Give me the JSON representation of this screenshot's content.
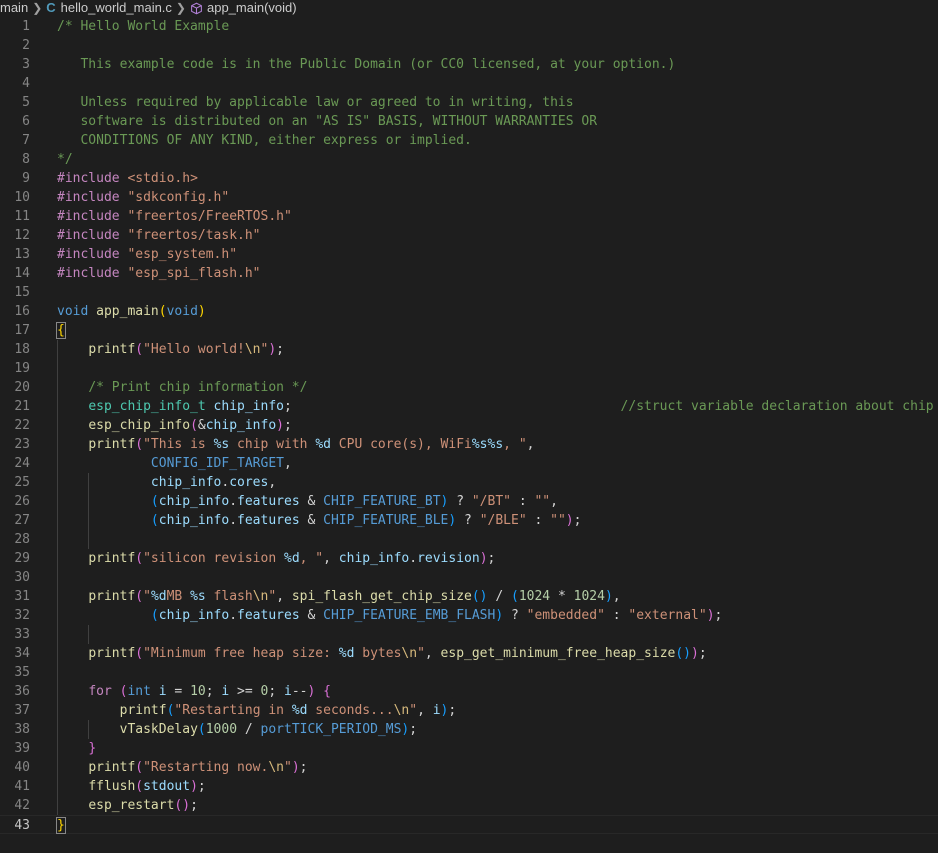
{
  "breadcrumb": {
    "folder": "main",
    "file": "hello_world_main.c",
    "file_icon": "C",
    "symbol": "app_main(void)"
  },
  "editor": {
    "current_line": 43,
    "lines": [
      {
        "n": "1",
        "t": [
          [
            "cm",
            "/* Hello World Example"
          ]
        ]
      },
      {
        "n": "2",
        "t": []
      },
      {
        "n": "3",
        "t": [
          [
            "cm",
            "   This example code is in the Public Domain (or CC0 licensed, at your option.)"
          ]
        ]
      },
      {
        "n": "4",
        "t": []
      },
      {
        "n": "5",
        "t": [
          [
            "cm",
            "   Unless required by applicable law or agreed to in writing, this"
          ]
        ]
      },
      {
        "n": "6",
        "t": [
          [
            "cm",
            "   software is distributed on an \"AS IS\" BASIS, WITHOUT WARRANTIES OR"
          ]
        ]
      },
      {
        "n": "7",
        "t": [
          [
            "cm",
            "   CONDITIONS OF ANY KIND, either express or implied."
          ]
        ]
      },
      {
        "n": "8",
        "t": [
          [
            "cm",
            "*/"
          ]
        ]
      },
      {
        "n": "9",
        "t": [
          [
            "pp",
            "#include "
          ],
          [
            "str",
            "<stdio.h>"
          ]
        ]
      },
      {
        "n": "10",
        "t": [
          [
            "pp",
            "#include "
          ],
          [
            "str",
            "\"sdkconfig.h\""
          ]
        ]
      },
      {
        "n": "11",
        "t": [
          [
            "pp",
            "#include "
          ],
          [
            "str",
            "\"freertos/FreeRTOS.h\""
          ]
        ]
      },
      {
        "n": "12",
        "t": [
          [
            "pp",
            "#include "
          ],
          [
            "str",
            "\"freertos/task.h\""
          ]
        ]
      },
      {
        "n": "13",
        "t": [
          [
            "pp",
            "#include "
          ],
          [
            "str",
            "\"esp_system.h\""
          ]
        ]
      },
      {
        "n": "14",
        "t": [
          [
            "pp",
            "#include "
          ],
          [
            "str",
            "\"esp_spi_flash.h\""
          ]
        ]
      },
      {
        "n": "15",
        "t": []
      },
      {
        "n": "16",
        "t": [
          [
            "kw",
            "void "
          ],
          [
            "fn",
            "app_main"
          ],
          [
            "br1",
            "("
          ],
          [
            "kw",
            "void"
          ],
          [
            "br1",
            ")"
          ]
        ]
      },
      {
        "n": "17",
        "t": [
          [
            "br1 brace-match",
            "{"
          ]
        ]
      },
      {
        "n": "18",
        "t": [
          [
            "pl",
            "    "
          ],
          [
            "fn",
            "printf"
          ],
          [
            "br2",
            "("
          ],
          [
            "str",
            "\"Hello world!"
          ],
          [
            "esc",
            "\\n"
          ],
          [
            "str",
            "\""
          ],
          [
            "br2",
            ")"
          ],
          [
            "pl",
            ";"
          ]
        ]
      },
      {
        "n": "19",
        "t": []
      },
      {
        "n": "20",
        "t": [
          [
            "pl",
            "    "
          ],
          [
            "cm",
            "/* Print chip information */"
          ]
        ]
      },
      {
        "n": "21",
        "t": [
          [
            "pl",
            "    "
          ],
          [
            "ty",
            "esp_chip_info_t "
          ],
          [
            "var",
            "chip_info"
          ],
          [
            "pl",
            ";                                          "
          ],
          [
            "cm",
            "//struct variable declaration about chip info"
          ]
        ]
      },
      {
        "n": "22",
        "t": [
          [
            "pl",
            "    "
          ],
          [
            "fn",
            "esp_chip_info"
          ],
          [
            "br2",
            "("
          ],
          [
            "pl",
            "&"
          ],
          [
            "var",
            "chip_info"
          ],
          [
            "br2",
            ")"
          ],
          [
            "pl",
            ";"
          ]
        ]
      },
      {
        "n": "23",
        "t": [
          [
            "pl",
            "    "
          ],
          [
            "fn",
            "printf"
          ],
          [
            "br2",
            "("
          ],
          [
            "str",
            "\"This is "
          ],
          [
            "fmt",
            "%s"
          ],
          [
            "str",
            " chip with "
          ],
          [
            "fmt",
            "%d"
          ],
          [
            "str",
            " CPU core(s), WiFi"
          ],
          [
            "fmt",
            "%s%s"
          ],
          [
            "str",
            ", \""
          ],
          [
            "pl",
            ","
          ]
        ]
      },
      {
        "n": "24",
        "t": [
          [
            "pl",
            "            "
          ],
          [
            "mac",
            "CONFIG_IDF_TARGET"
          ],
          [
            "pl",
            ","
          ]
        ]
      },
      {
        "n": "25",
        "t": [
          [
            "pl",
            "            "
          ],
          [
            "var",
            "chip_info"
          ],
          [
            "pl",
            "."
          ],
          [
            "var",
            "cores"
          ],
          [
            "pl",
            ","
          ]
        ]
      },
      {
        "n": "26",
        "t": [
          [
            "pl",
            "            "
          ],
          [
            "br3",
            "("
          ],
          [
            "var",
            "chip_info"
          ],
          [
            "pl",
            "."
          ],
          [
            "var",
            "features"
          ],
          [
            "pl",
            " & "
          ],
          [
            "mac",
            "CHIP_FEATURE_BT"
          ],
          [
            "br3",
            ")"
          ],
          [
            "pl",
            " ? "
          ],
          [
            "str",
            "\"/BT\""
          ],
          [
            "pl",
            " : "
          ],
          [
            "str",
            "\"\""
          ],
          [
            "pl",
            ","
          ]
        ]
      },
      {
        "n": "27",
        "t": [
          [
            "pl",
            "            "
          ],
          [
            "br3",
            "("
          ],
          [
            "var",
            "chip_info"
          ],
          [
            "pl",
            "."
          ],
          [
            "var",
            "features"
          ],
          [
            "pl",
            " & "
          ],
          [
            "mac",
            "CHIP_FEATURE_BLE"
          ],
          [
            "br3",
            ")"
          ],
          [
            "pl",
            " ? "
          ],
          [
            "str",
            "\"/BLE\""
          ],
          [
            "pl",
            " : "
          ],
          [
            "str",
            "\"\""
          ],
          [
            "br2",
            ")"
          ],
          [
            "pl",
            ";"
          ]
        ]
      },
      {
        "n": "28",
        "t": []
      },
      {
        "n": "29",
        "t": [
          [
            "pl",
            "    "
          ],
          [
            "fn",
            "printf"
          ],
          [
            "br2",
            "("
          ],
          [
            "str",
            "\"silicon revision "
          ],
          [
            "fmt",
            "%d"
          ],
          [
            "str",
            ", \""
          ],
          [
            "pl",
            ", "
          ],
          [
            "var",
            "chip_info"
          ],
          [
            "pl",
            "."
          ],
          [
            "var",
            "revision"
          ],
          [
            "br2",
            ")"
          ],
          [
            "pl",
            ";"
          ]
        ]
      },
      {
        "n": "30",
        "t": []
      },
      {
        "n": "31",
        "t": [
          [
            "pl",
            "    "
          ],
          [
            "fn",
            "printf"
          ],
          [
            "br2",
            "("
          ],
          [
            "str",
            "\""
          ],
          [
            "fmt",
            "%d"
          ],
          [
            "str",
            "MB "
          ],
          [
            "fmt",
            "%s"
          ],
          [
            "str",
            " flash"
          ],
          [
            "esc",
            "\\n"
          ],
          [
            "str",
            "\""
          ],
          [
            "pl",
            ", "
          ],
          [
            "fn",
            "spi_flash_get_chip_size"
          ],
          [
            "br3",
            "()"
          ],
          [
            "pl",
            " / "
          ],
          [
            "br3",
            "("
          ],
          [
            "num",
            "1024"
          ],
          [
            "pl",
            " * "
          ],
          [
            "num",
            "1024"
          ],
          [
            "br3",
            ")"
          ],
          [
            "pl",
            ","
          ]
        ]
      },
      {
        "n": "32",
        "t": [
          [
            "pl",
            "            "
          ],
          [
            "br3",
            "("
          ],
          [
            "var",
            "chip_info"
          ],
          [
            "pl",
            "."
          ],
          [
            "var",
            "features"
          ],
          [
            "pl",
            " & "
          ],
          [
            "mac",
            "CHIP_FEATURE_EMB_FLASH"
          ],
          [
            "br3",
            ")"
          ],
          [
            "pl",
            " ? "
          ],
          [
            "str",
            "\"embedded\""
          ],
          [
            "pl",
            " : "
          ],
          [
            "str",
            "\"external\""
          ],
          [
            "br2",
            ")"
          ],
          [
            "pl",
            ";"
          ]
        ]
      },
      {
        "n": "33",
        "t": []
      },
      {
        "n": "34",
        "t": [
          [
            "pl",
            "    "
          ],
          [
            "fn",
            "printf"
          ],
          [
            "br2",
            "("
          ],
          [
            "str",
            "\"Minimum free heap size: "
          ],
          [
            "fmt",
            "%d"
          ],
          [
            "str",
            " bytes"
          ],
          [
            "esc",
            "\\n"
          ],
          [
            "str",
            "\""
          ],
          [
            "pl",
            ", "
          ],
          [
            "fn",
            "esp_get_minimum_free_heap_size"
          ],
          [
            "br3",
            "()"
          ],
          [
            "br2",
            ")"
          ],
          [
            "pl",
            ";"
          ]
        ]
      },
      {
        "n": "35",
        "t": []
      },
      {
        "n": "36",
        "t": [
          [
            "pl",
            "    "
          ],
          [
            "pp",
            "for"
          ],
          [
            "pl",
            " "
          ],
          [
            "br2",
            "("
          ],
          [
            "kw",
            "int"
          ],
          [
            "pl",
            " "
          ],
          [
            "var",
            "i"
          ],
          [
            "pl",
            " = "
          ],
          [
            "num",
            "10"
          ],
          [
            "pl",
            "; "
          ],
          [
            "var",
            "i"
          ],
          [
            "pl",
            " >= "
          ],
          [
            "num",
            "0"
          ],
          [
            "pl",
            "; "
          ],
          [
            "var",
            "i"
          ],
          [
            "pl",
            "--"
          ],
          [
            "br2",
            ")"
          ],
          [
            "pl",
            " "
          ],
          [
            "br2",
            "{"
          ]
        ]
      },
      {
        "n": "37",
        "t": [
          [
            "pl",
            "        "
          ],
          [
            "fn",
            "printf"
          ],
          [
            "br3",
            "("
          ],
          [
            "str",
            "\"Restarting in "
          ],
          [
            "fmt",
            "%d"
          ],
          [
            "str",
            " seconds..."
          ],
          [
            "esc",
            "\\n"
          ],
          [
            "str",
            "\""
          ],
          [
            "pl",
            ", "
          ],
          [
            "var",
            "i"
          ],
          [
            "br3",
            ")"
          ],
          [
            "pl",
            ";"
          ]
        ]
      },
      {
        "n": "38",
        "t": [
          [
            "pl",
            "        "
          ],
          [
            "fn",
            "vTaskDelay"
          ],
          [
            "br3",
            "("
          ],
          [
            "num",
            "1000"
          ],
          [
            "pl",
            " / "
          ],
          [
            "mac",
            "portTICK_PERIOD_MS"
          ],
          [
            "br3",
            ")"
          ],
          [
            "pl",
            ";"
          ]
        ]
      },
      {
        "n": "39",
        "t": [
          [
            "pl",
            "    "
          ],
          [
            "br2",
            "}"
          ]
        ]
      },
      {
        "n": "40",
        "t": [
          [
            "pl",
            "    "
          ],
          [
            "fn",
            "printf"
          ],
          [
            "br2",
            "("
          ],
          [
            "str",
            "\"Restarting now."
          ],
          [
            "esc",
            "\\n"
          ],
          [
            "str",
            "\""
          ],
          [
            "br2",
            ")"
          ],
          [
            "pl",
            ";"
          ]
        ]
      },
      {
        "n": "41",
        "t": [
          [
            "pl",
            "    "
          ],
          [
            "fn",
            "fflush"
          ],
          [
            "br2",
            "("
          ],
          [
            "var",
            "stdout"
          ],
          [
            "br2",
            ")"
          ],
          [
            "pl",
            ";"
          ]
        ]
      },
      {
        "n": "42",
        "t": [
          [
            "pl",
            "    "
          ],
          [
            "fn",
            "esp_restart"
          ],
          [
            "br2",
            "()"
          ],
          [
            "pl",
            ";"
          ]
        ]
      },
      {
        "n": "43",
        "t": [
          [
            "br1 brace-match",
            "}"
          ]
        ]
      }
    ]
  }
}
